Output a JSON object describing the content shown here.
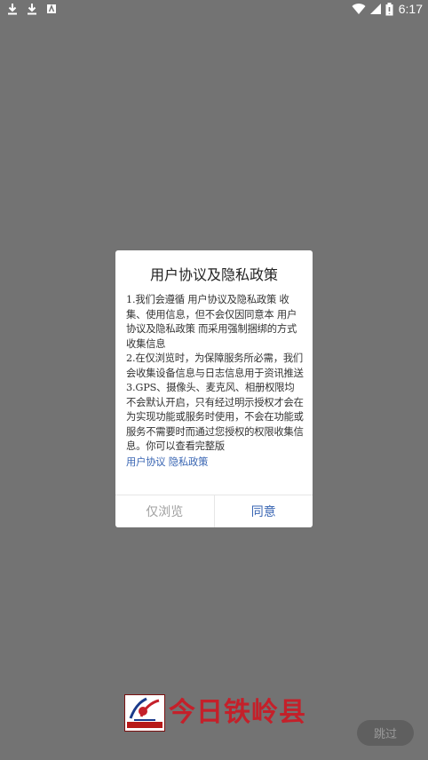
{
  "status_bar": {
    "time": "6:17",
    "left_icons": [
      "download-icon",
      "download-icon",
      "app-notification-icon"
    ],
    "right_icons": [
      "wifi-icon",
      "signal-icon",
      "battery-icon"
    ]
  },
  "dialog": {
    "title": "用户协议及隐私政策",
    "paragraphs": [
      "1.我们会遵循 用户协议及隐私政策 收集、使用信息，但不会仅因同意本 用户协议及隐私政策 而采用强制捆绑的方式收集信息",
      "2.在仅浏览时，为保障服务所必需，我们会收集设备信息与日志信息用于资讯推送",
      "3.GPS、摄像头、麦克风、相册权限均不会默认开启，只有经过明示授权才会在为实现功能或服务时使用，不会在功能或服务不需要时而通过您授权的权限收集信息。你可以查看完整版"
    ],
    "link_user_agreement": "用户协议",
    "link_privacy_policy": "隐私政策",
    "button_browse": "仅浏览",
    "button_agree": "同意"
  },
  "logo": {
    "text": "今日铁岭县",
    "colors": {
      "brand_red": "#c4202a"
    }
  },
  "skip_button": "跳过",
  "colors": {
    "overlay": "#737373",
    "link": "#3a66b3",
    "disabled_text": "#a0a0a0"
  }
}
